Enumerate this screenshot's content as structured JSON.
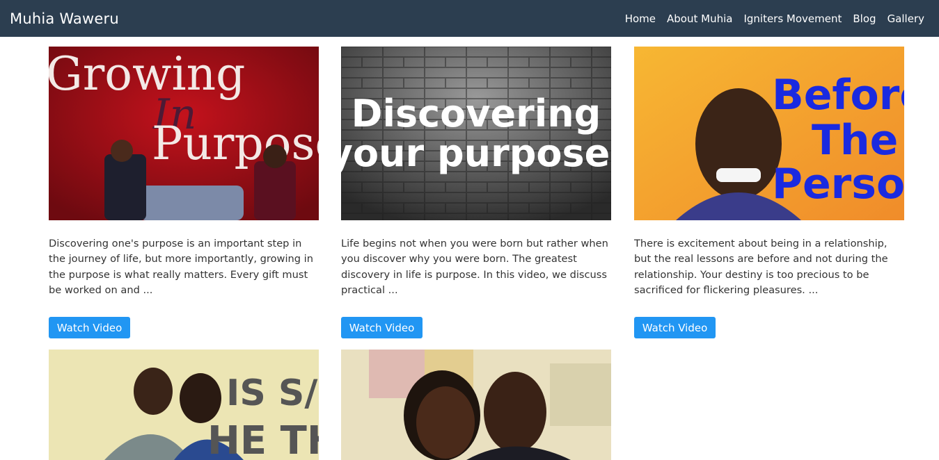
{
  "brand": "Muhia Waweru",
  "nav": [
    "Home",
    "About Muhia",
    "Igniters Movement",
    "Blog",
    "Gallery"
  ],
  "cards": [
    {
      "image_text": [
        "Growing",
        "In",
        "Purpose"
      ],
      "description": "Discovering one's purpose is an important step in the journey of life, but more importantly, growing in the purpose is what really matters. Every gift must be worked on and ...",
      "button": "Watch Video"
    },
    {
      "image_text": [
        "Discovering",
        "your purpose"
      ],
      "description": "Life begins not when you were born but rather when you discover why you were born. The greatest discovery in life is purpose. In this video, we discuss practical ...",
      "button": "Watch Video"
    },
    {
      "image_text": [
        "Before",
        "The",
        "Person"
      ],
      "description": "There is excitement about being in a relationship, but the real lessons are before and not during the relationship. Your destiny is too precious to be sacrificed for flickering pleasures. ...",
      "button": "Watch Video"
    },
    {
      "image_text": [
        "IS S/",
        "HE THE"
      ]
    },
    {
      "image_text": []
    }
  ],
  "colors": {
    "navbar": "#2c3e50",
    "button": "#2196f3"
  }
}
